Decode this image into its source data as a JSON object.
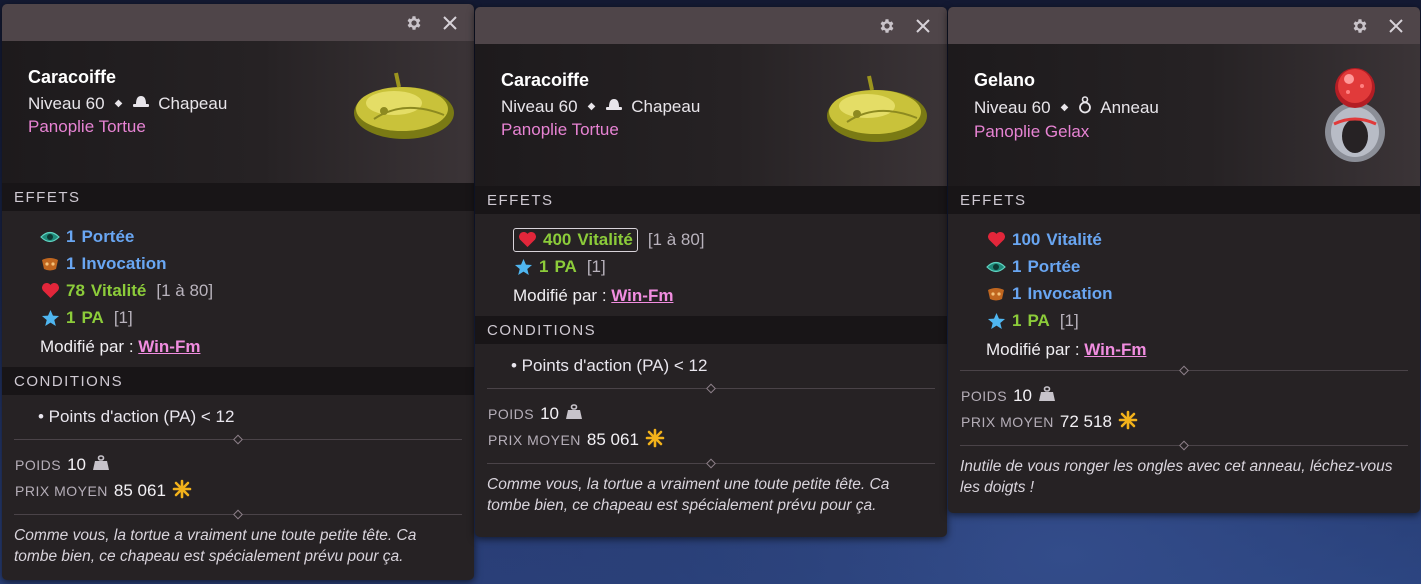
{
  "labels": {
    "effects": "EFFETS",
    "conditions": "CONDITIONS",
    "weight": "POIDS",
    "avg_price": "PRIX MOYEN",
    "modified_by": "Modifié par :"
  },
  "colors": {
    "set_name": "#e783d3",
    "blue_effect": "#69a6f2",
    "green_effect": "#8ccc3a",
    "mod_link": "#f18de0",
    "titlebar": "#4f4549",
    "panel_bg": "#262224"
  },
  "panels": [
    {
      "name": "Caracoiffe",
      "level": "Niveau 60",
      "type": "Chapeau",
      "type_icon": "hat-icon",
      "set": "Panoplie Tortue",
      "effects": [
        {
          "icon": "eye-icon",
          "value": "1",
          "stat": "Portée",
          "color": "blue",
          "range": ""
        },
        {
          "icon": "invocation-icon",
          "value": "1",
          "stat": "Invocation",
          "color": "blue",
          "range": ""
        },
        {
          "icon": "heart-icon",
          "value": "78",
          "stat": "Vitalité",
          "color": "green",
          "range": "[1 à 80]"
        },
        {
          "icon": "star-icon",
          "value": "1",
          "stat": "PA",
          "color": "green",
          "range": "[1]"
        }
      ],
      "modified_by": "Win-Fm",
      "condition": "• Points d'action (PA) < 12",
      "weight": "10",
      "price": "85 061",
      "description": "Comme vous, la tortue a vraiment une toute petite tête. Ca tombe bien, ce chapeau est spécialement prévu pour ça."
    },
    {
      "name": "Caracoiffe",
      "level": "Niveau 60",
      "type": "Chapeau",
      "type_icon": "hat-icon",
      "set": "Panoplie Tortue",
      "effects": [
        {
          "icon": "heart-icon",
          "value": "400",
          "stat": "Vitalité",
          "color": "green",
          "range": "[1 à 80]",
          "boxed": true
        },
        {
          "icon": "star-icon",
          "value": "1",
          "stat": "PA",
          "color": "green",
          "range": "[1]"
        }
      ],
      "modified_by": "Win-Fm",
      "condition": "• Points d'action (PA) < 12",
      "weight": "10",
      "price": "85 061",
      "description": "Comme vous, la tortue a vraiment une toute petite tête. Ca tombe bien, ce chapeau est spécialement prévu pour ça."
    },
    {
      "name": "Gelano",
      "level": "Niveau 60",
      "type": "Anneau",
      "type_icon": "ring-icon",
      "set": "Panoplie Gelax",
      "effects": [
        {
          "icon": "heart-icon",
          "value": "100",
          "stat": "Vitalité",
          "color": "blue",
          "range": ""
        },
        {
          "icon": "eye-icon",
          "value": "1",
          "stat": "Portée",
          "color": "blue",
          "range": ""
        },
        {
          "icon": "invocation-icon",
          "value": "1",
          "stat": "Invocation",
          "color": "blue",
          "range": ""
        },
        {
          "icon": "star-icon",
          "value": "1",
          "stat": "PA",
          "color": "green",
          "range": "[1]"
        }
      ],
      "modified_by": "Win-Fm",
      "condition": "",
      "weight": "10",
      "price": "72 518",
      "description": "Inutile de vous ronger les ongles avec cet anneau, léchez-vous les doigts !"
    }
  ]
}
